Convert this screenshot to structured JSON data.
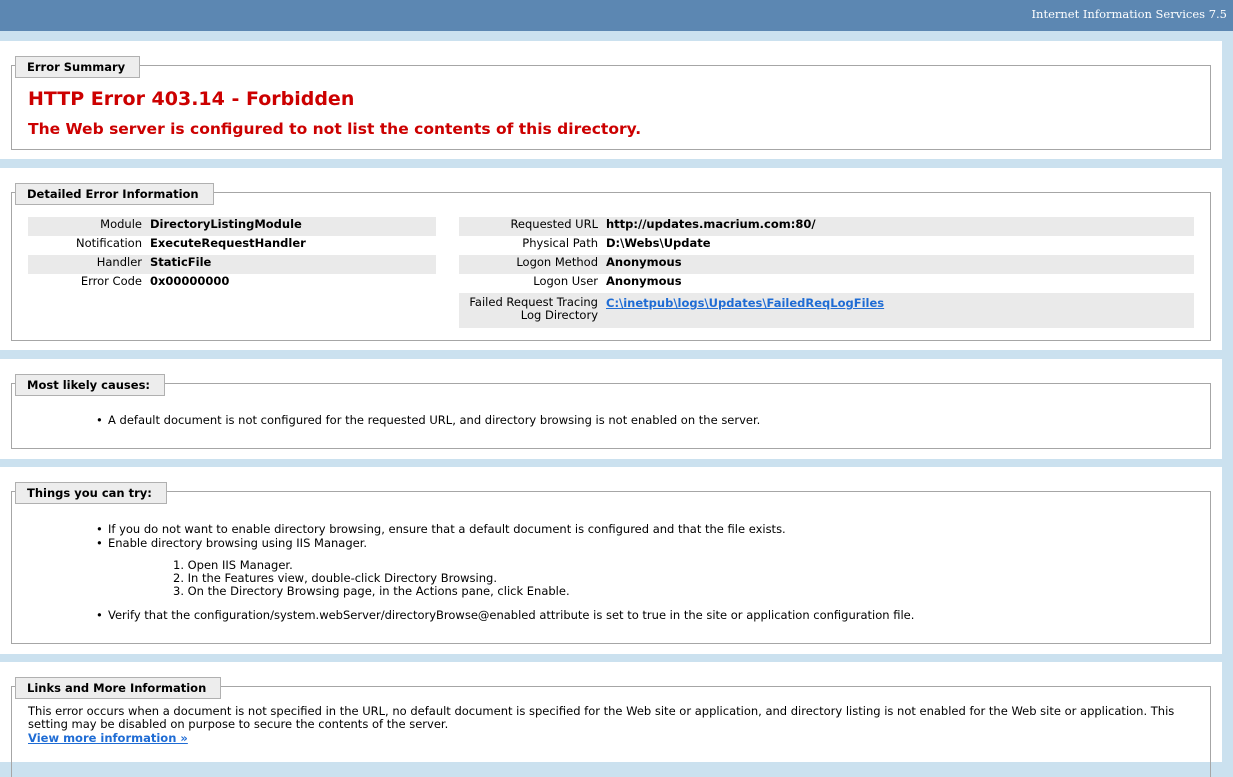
{
  "header": {
    "title": "Internet Information Services 7.5"
  },
  "summary": {
    "legend": "Error Summary",
    "error_code": "HTTP Error 403.14 - Forbidden",
    "error_message": "The Web server is configured to not list the contents of this directory."
  },
  "details": {
    "legend": "Detailed Error Information",
    "left": [
      {
        "label": "Module",
        "value": "DirectoryListingModule"
      },
      {
        "label": "Notification",
        "value": "ExecuteRequestHandler"
      },
      {
        "label": "Handler",
        "value": "StaticFile"
      },
      {
        "label": "Error Code",
        "value": "0x00000000"
      }
    ],
    "right": [
      {
        "label": "Requested URL",
        "value": "http://updates.macrium.com:80/"
      },
      {
        "label": "Physical Path",
        "value": "D:\\Webs\\Update"
      },
      {
        "label": "Logon Method",
        "value": "Anonymous"
      },
      {
        "label": "Logon User",
        "value": "Anonymous"
      }
    ],
    "trace": {
      "label_line1": "Failed Request Tracing",
      "label_line2": "Log Directory",
      "value": "C:\\inetpub\\logs\\Updates\\FailedReqLogFiles"
    }
  },
  "causes": {
    "legend": "Most likely causes:",
    "items": [
      "A default document is not configured for the requested URL, and directory browsing is not enabled on the server."
    ]
  },
  "try": {
    "legend": "Things you can try:",
    "bullet1": "If you do not want to enable directory browsing, ensure that a default document is configured and that the file exists.",
    "bullet2": "Enable directory browsing using IIS Manager.",
    "steps": [
      "1. Open IIS Manager.",
      "2. In the Features view, double-click Directory Browsing.",
      "3. On the Directory Browsing page, in the Actions pane, click Enable."
    ],
    "bullet3": "Verify that the configuration/system.webServer/directoryBrowse@enabled attribute is set to true in the site or application configuration file."
  },
  "links": {
    "legend": "Links and More Information",
    "text": "This error occurs when a document is not specified in the URL, no default document is specified for the Web site or application, and directory listing is not enabled for the Web site or application. This setting may be disabled on purpose to secure the contents of the server.",
    "view_more": "View more information »"
  },
  "colors": {
    "header_bg": "#5C87B2",
    "page_bg": "#CBE1EF",
    "error_red": "#CC0000",
    "link_blue": "#1F6CD4"
  }
}
